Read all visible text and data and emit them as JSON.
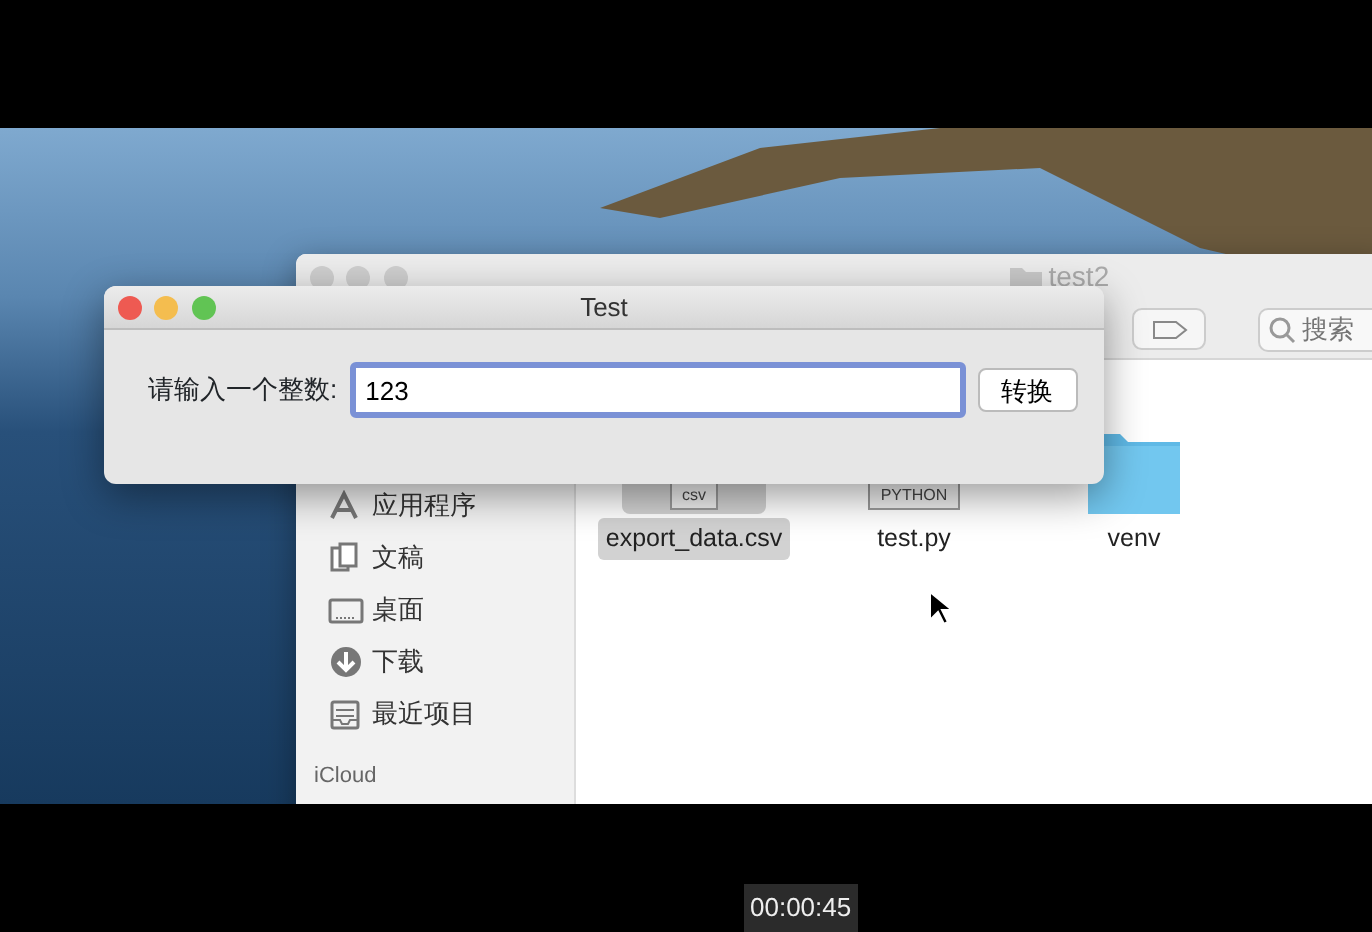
{
  "finder": {
    "title": "test2",
    "search": {
      "placeholder": "搜索"
    },
    "sidebar": {
      "items": [
        {
          "label": "应用程序",
          "kind": "apps"
        },
        {
          "label": "文稿",
          "kind": "docs"
        },
        {
          "label": "桌面",
          "kind": "desktop"
        },
        {
          "label": "下载",
          "kind": "downloads"
        },
        {
          "label": "最近项目",
          "kind": "recents"
        }
      ],
      "sections": [
        {
          "label": "iCloud"
        }
      ]
    },
    "files": [
      {
        "name": "export_data.csv",
        "kind": "document",
        "badge": "csv",
        "selected": true
      },
      {
        "name": "test.py",
        "kind": "document",
        "badge": "PYTHON",
        "selected": false
      },
      {
        "name": "venv",
        "kind": "folder",
        "selected": false
      }
    ]
  },
  "dialog": {
    "title": "Test",
    "label": "请输入一个整数:",
    "input": {
      "value": "123",
      "focused": true
    },
    "button": "转换"
  },
  "video": {
    "timestamp": "00:00:45"
  }
}
